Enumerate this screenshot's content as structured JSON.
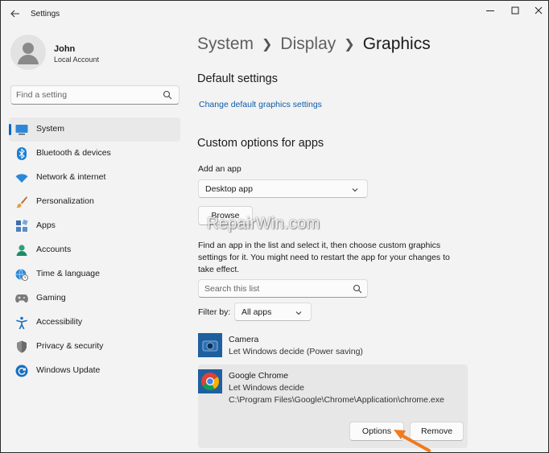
{
  "window": {
    "title": "Settings"
  },
  "profile": {
    "name": "John",
    "account_type": "Local Account"
  },
  "search": {
    "placeholder": "Find a setting"
  },
  "sidebar": {
    "items": [
      {
        "label": "System",
        "icon": "system-icon",
        "active": true
      },
      {
        "label": "Bluetooth & devices",
        "icon": "bluetooth-icon"
      },
      {
        "label": "Network & internet",
        "icon": "wifi-icon"
      },
      {
        "label": "Personalization",
        "icon": "brush-icon"
      },
      {
        "label": "Apps",
        "icon": "apps-icon"
      },
      {
        "label": "Accounts",
        "icon": "accounts-icon"
      },
      {
        "label": "Time & language",
        "icon": "globe-clock-icon"
      },
      {
        "label": "Gaming",
        "icon": "gamepad-icon"
      },
      {
        "label": "Accessibility",
        "icon": "accessibility-icon"
      },
      {
        "label": "Privacy & security",
        "icon": "shield-icon"
      },
      {
        "label": "Windows Update",
        "icon": "update-icon"
      }
    ]
  },
  "breadcrumb": {
    "items": [
      "System",
      "Display",
      "Graphics"
    ]
  },
  "default_settings": {
    "title": "Default settings",
    "link": "Change default graphics settings"
  },
  "custom_options": {
    "title": "Custom options for apps",
    "add_app_label": "Add an app",
    "app_type_selected": "Desktop app",
    "browse_label": "Browse",
    "description": "Find an app in the list and select it, then choose custom graphics settings for it. You might need to restart the app for your changes to take effect.",
    "list_search_placeholder": "Search this list",
    "filter_label": "Filter by:",
    "filter_selected": "All apps"
  },
  "apps": [
    {
      "name": "Camera",
      "setting": "Let Windows decide (Power saving)"
    },
    {
      "name": "Google Chrome",
      "setting": "Let Windows decide",
      "path": "C:\\Program Files\\Google\\Chrome\\Application\\chrome.exe"
    }
  ],
  "actions": {
    "options_label": "Options",
    "remove_label": "Remove"
  },
  "watermark": "RepairWin.com",
  "colors": {
    "accent": "#0067c0",
    "link": "#0f5ca8",
    "annotation_arrow": "#f07a1e"
  }
}
